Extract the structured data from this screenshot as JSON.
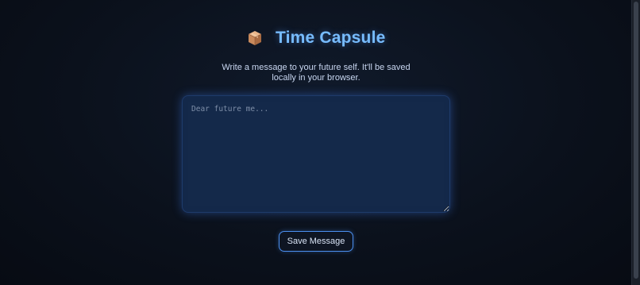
{
  "header": {
    "icon": "package-icon",
    "title": "Time Capsule"
  },
  "subtitle": "Write a message to your future self. It'll be saved locally in your browser.",
  "message": {
    "placeholder": "Dear future me...",
    "value": ""
  },
  "actions": {
    "save_label": "Save Message"
  },
  "colors": {
    "accent": "#77bcff",
    "button_border": "#4b8ff0",
    "textarea_bg": "#14294a",
    "page_bg": "#0b111c"
  }
}
